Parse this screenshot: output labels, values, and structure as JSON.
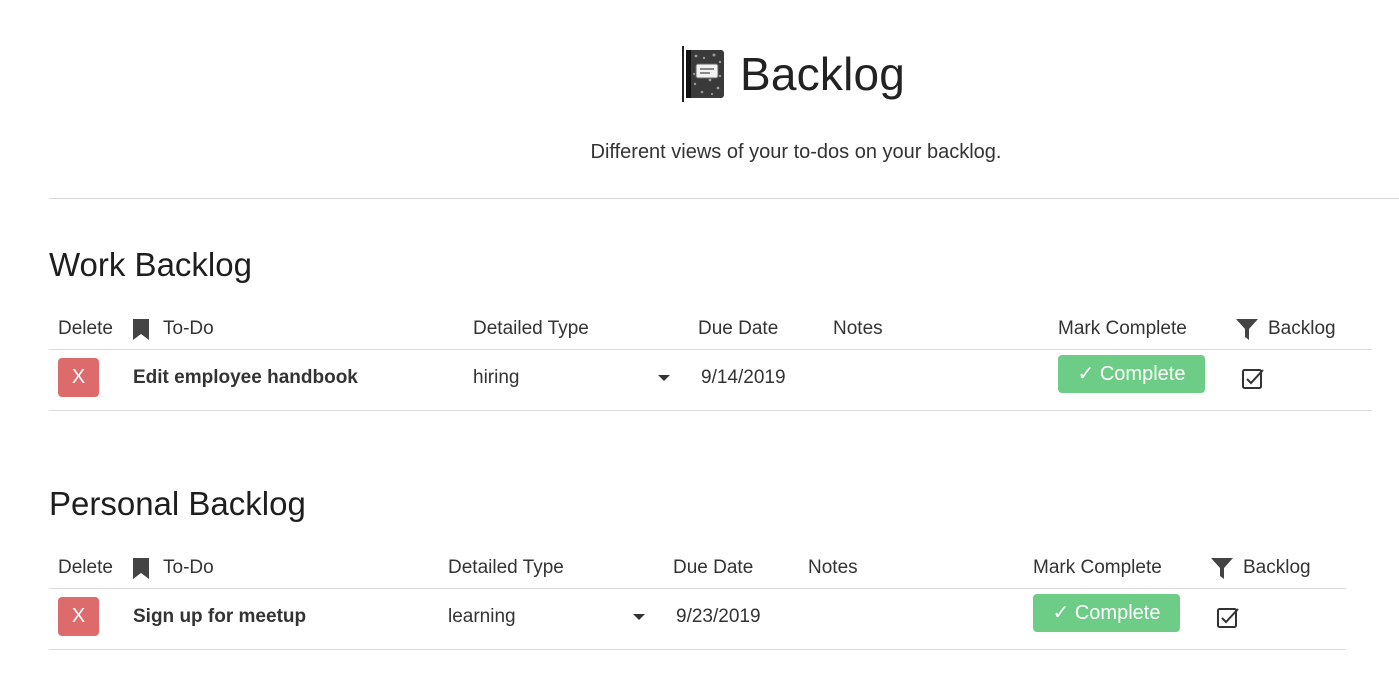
{
  "page": {
    "title": "Backlog",
    "book_icon": "composition-notebook-icon",
    "subtitle": "Different views of your to-dos on your backlog."
  },
  "colors": {
    "delete": "#dd6b6b",
    "complete": "#6dcc85",
    "divider": "#dcdcdc",
    "text": "#333333"
  },
  "columns": {
    "delete": "Delete",
    "todo": "To-Do",
    "todo_icon": "bookmark-icon",
    "detailed_type": "Detailed Type",
    "due_date": "Due Date",
    "notes": "Notes",
    "mark_complete": "Mark Complete",
    "backlog": "Backlog",
    "backlog_icon": "filter-icon"
  },
  "sections": [
    {
      "title": "Work Backlog",
      "rows": [
        {
          "delete_label": "X",
          "todo": "Edit employee handbook",
          "detailed_type": "hiring",
          "due_date": "9/14/2019",
          "notes": "",
          "complete_label": "✓ Complete",
          "backlog_checked": true
        }
      ]
    },
    {
      "title": "Personal Backlog",
      "rows": [
        {
          "delete_label": "X",
          "todo": "Sign up for meetup",
          "detailed_type": "learning",
          "due_date": "9/23/2019",
          "notes": "",
          "complete_label": "✓ Complete",
          "backlog_checked": true
        }
      ]
    }
  ]
}
